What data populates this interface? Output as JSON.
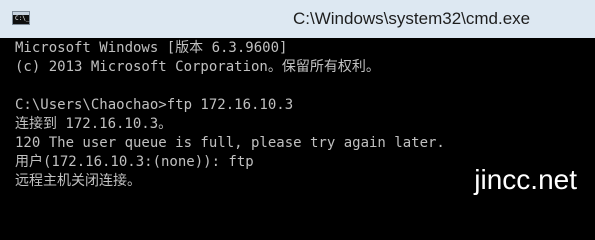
{
  "window": {
    "title": "C:\\Windows\\system32\\cmd.exe",
    "icon": "console-icon"
  },
  "console": {
    "lines": [
      "Microsoft Windows [版本 6.3.9600]",
      "(c) 2013 Microsoft Corporation。保留所有权利。",
      "C:\\Users\\Chaochao>ftp 172.16.10.3",
      "连接到 172.16.10.3。",
      "120 The user queue is full, please try again later.",
      "用户(172.16.10.3:(none)): ftp",
      "远程主机关闭连接。"
    ]
  },
  "watermark": {
    "text": "jincc.net"
  },
  "colors": {
    "titlebar_bg": "#dde8f2",
    "console_bg": "#000000",
    "console_text": "#c0c0c0",
    "watermark": "#ffffff"
  }
}
